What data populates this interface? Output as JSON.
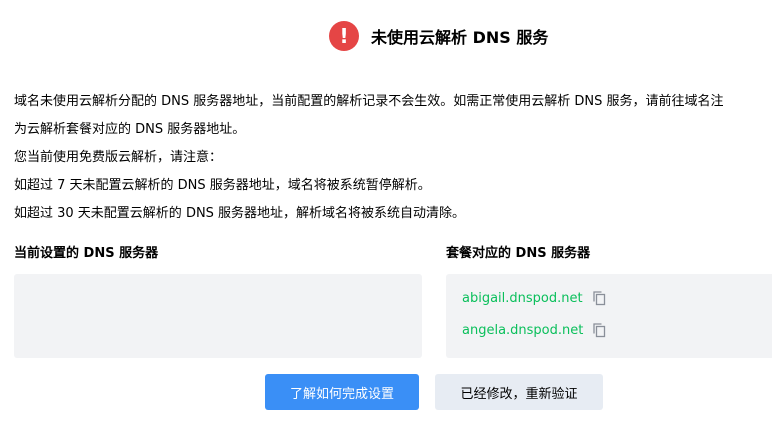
{
  "header": {
    "icon": "alert-exclamation-icon",
    "icon_glyph": "!",
    "title": "未使用云解析 DNS 服务",
    "icon_color": "#e54545"
  },
  "description": {
    "lines": [
      "域名未使用云解析分配的 DNS 服务器地址，当前配置的解析记录不会生效。如需正常使用云解析 DNS 服务，请前往域名注",
      "为云解析套餐对应的 DNS 服务器地址。",
      "您当前使用免费版云解析，请注意：",
      "如超过 7 天未配置云解析的 DNS 服务器地址，域名将被系统暂停解析。",
      "如超过 30 天未配置云解析的 DNS 服务器地址，解析域名将被系统自动清除。"
    ]
  },
  "current_dns": {
    "heading": "当前设置的 DNS 服务器",
    "servers": []
  },
  "package_dns": {
    "heading": "套餐对应的 DNS 服务器",
    "servers": [
      {
        "name": "abigail.dnspod.net",
        "icon": "copy-icon"
      },
      {
        "name": "angela.dnspod.net",
        "icon": "copy-icon"
      }
    ],
    "server_color": "#0abf5b"
  },
  "actions": {
    "learn_label": "了解如何完成设置",
    "verify_label": "已经修改，重新验证",
    "primary_color": "#3a8ff6"
  }
}
